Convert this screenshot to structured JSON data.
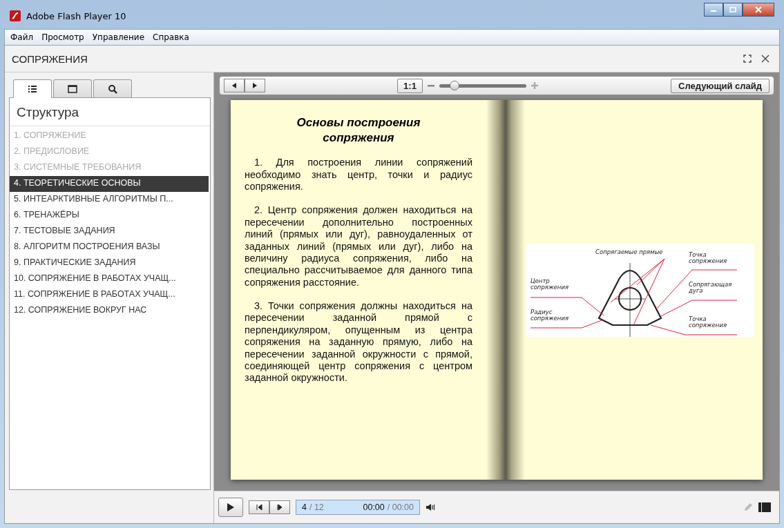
{
  "window": {
    "title": "Adobe Flash Player 10"
  },
  "menu": [
    "Файл",
    "Просмотр",
    "Управление",
    "Справка"
  ],
  "header": {
    "title": "СОПРЯЖЕНИЯ"
  },
  "sidebar": {
    "tabs": [
      {
        "kind": "outline",
        "selected": true
      },
      {
        "kind": "thumbnails",
        "selected": false
      },
      {
        "kind": "search",
        "selected": false
      }
    ],
    "heading": "Структура",
    "items": [
      {
        "label": "1.  СОПРЯЖЕНИЕ",
        "visited": true,
        "selected": false
      },
      {
        "label": "2.  ПРЕДИСЛОВИЕ",
        "visited": true,
        "selected": false
      },
      {
        "label": "3.  СИСТЕМНЫЕ ТРЕБОВАНИЯ",
        "visited": true,
        "selected": false
      },
      {
        "label": "4.  ТЕОРЕТИЧЕСКИЕ ОСНОВЫ",
        "visited": false,
        "selected": true
      },
      {
        "label": "5.  ИНТЕАРКТИВНЫЕ АЛГОРИТМЫ П...",
        "visited": false,
        "selected": false
      },
      {
        "label": "6.  ТРЕНАЖЁРЫ",
        "visited": false,
        "selected": false
      },
      {
        "label": "7.  ТЕСТОВЫЕ ЗАДАНИЯ",
        "visited": false,
        "selected": false
      },
      {
        "label": "8.  АЛГОРИТМ ПОСТРОЕНИЯ ВАЗЫ",
        "visited": false,
        "selected": false
      },
      {
        "label": "9.  ПРАКТИЧЕСКИЕ ЗАДАНИЯ",
        "visited": false,
        "selected": false
      },
      {
        "label": "10. СОПРЯЖЕНИЕ В РАБОТАХ УЧАЩ...",
        "visited": false,
        "selected": false
      },
      {
        "label": "11. СОПРЯЖЕНИЕ В РАБОТАХ УЧАЩ...",
        "visited": false,
        "selected": false
      },
      {
        "label": "12. СОПРЯЖЕНИЕ ВОКРУГ НАС",
        "visited": false,
        "selected": false
      }
    ]
  },
  "toolbar": {
    "zoom_reset": "1:1",
    "zoom": {
      "level": 0.12
    },
    "next_button": "Следующий слайд"
  },
  "slide": {
    "title": "Основы построения сопряжения",
    "paragraphs": [
      "1. Для построения линии сопряжений необходимо знать центр, точки и радиус сопряжения.",
      "2. Центр сопряжения должен находиться на пересечении дополнительно построенных линий (прямых или дуг), равноудаленных от заданных линий (прямых или дуг), либо на величину радиуса сопряжения, либо на специально рассчитываемое для данного типа сопряжения расстояние.",
      "3. Точки сопряжения должны находиться на пересечении заданной прямой с перпендикуляром, опущенным из центра сопряжения на заданную прямую, либо на пересечении заданной окружности с прямой, соединяющей центр сопряжения с центром заданной окружности."
    ],
    "figure_labels": [
      "Сопрягаемые прямые",
      "Точка сопряжения",
      "Центр сопряжения",
      "Сопрягающая дуга",
      "Радиус сопряжения",
      "Точка сопряжения"
    ]
  },
  "player": {
    "current": "4",
    "total": "/ 12",
    "time": "00:00",
    "duration": "/ 00:00"
  }
}
